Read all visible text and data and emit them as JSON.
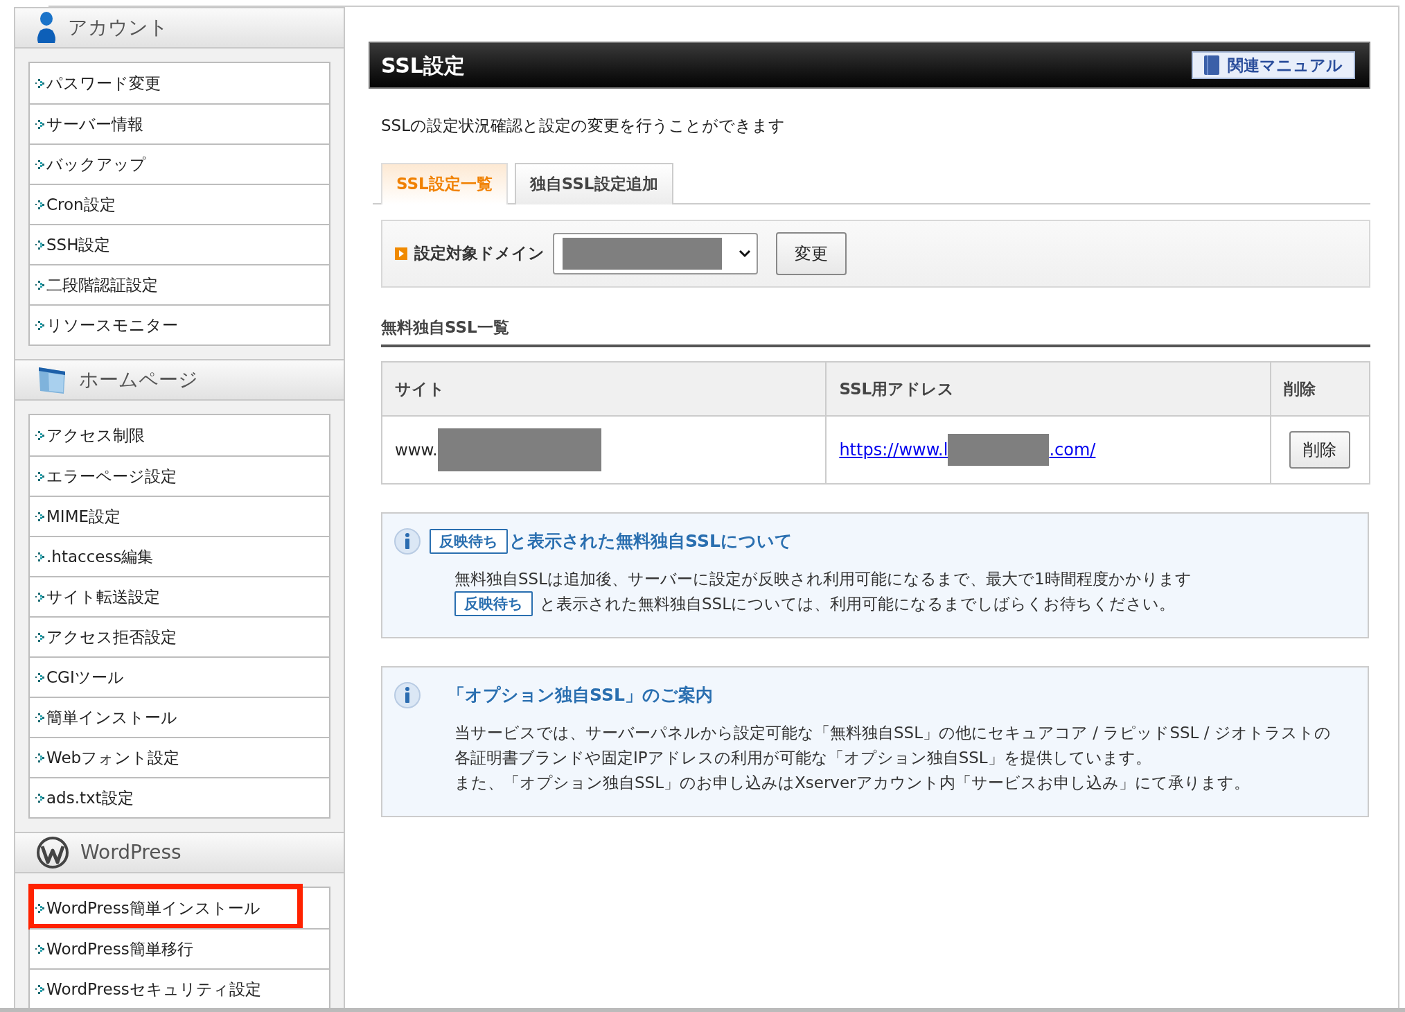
{
  "sidebar": {
    "sections": [
      {
        "kind": "account",
        "title": "アカウント",
        "items": [
          {
            "label": "パスワード変更",
            "highlighted": false
          },
          {
            "label": "サーバー情報",
            "highlighted": false
          },
          {
            "label": "バックアップ",
            "highlighted": false
          },
          {
            "label": "Cron設定",
            "highlighted": false
          },
          {
            "label": "SSH設定",
            "highlighted": false
          },
          {
            "label": "二段階認証設定",
            "highlighted": false
          },
          {
            "label": "リソースモニター",
            "highlighted": false
          }
        ]
      },
      {
        "kind": "homepage",
        "title": "ホームページ",
        "items": [
          {
            "label": "アクセス制限",
            "highlighted": false
          },
          {
            "label": "エラーページ設定",
            "highlighted": false
          },
          {
            "label": "MIME設定",
            "highlighted": false
          },
          {
            "label": ".htaccess編集",
            "highlighted": false
          },
          {
            "label": "サイト転送設定",
            "highlighted": false
          },
          {
            "label": "アクセス拒否設定",
            "highlighted": false
          },
          {
            "label": "CGIツール",
            "highlighted": false
          },
          {
            "label": "簡単インストール",
            "highlighted": false
          },
          {
            "label": "Webフォント設定",
            "highlighted": false
          },
          {
            "label": "ads.txt設定",
            "highlighted": false
          }
        ]
      },
      {
        "kind": "wordpress",
        "title": "WordPress",
        "items": [
          {
            "label": "WordPress簡単インストール",
            "highlighted": true
          },
          {
            "label": "WordPress簡単移行",
            "highlighted": false
          },
          {
            "label": "WordPressセキュリティ設定",
            "highlighted": false
          }
        ]
      }
    ]
  },
  "main": {
    "title": "SSL設定",
    "manual_button": "関連マニュアル",
    "description": "SSLの設定状況確認と設定の変更を行うことができます",
    "tabs": [
      {
        "label": "SSL設定一覧",
        "selected": true
      },
      {
        "label": "独自SSL設定追加",
        "selected": false
      }
    ],
    "domain_filter": {
      "label": "設定対象ドメイン",
      "button": "変更"
    },
    "section_title": "無料独自SSL一覧",
    "table": {
      "columns": [
        "サイト",
        "SSL用アドレス",
        "削除"
      ],
      "rows": [
        {
          "site": "www.",
          "url_start": "https://www.l",
          "url_end": ".com/",
          "action": "削除"
        }
      ]
    },
    "notices": [
      {
        "title_badge": "反映待ち",
        "title": "と表示された無料独自SSLについて",
        "lines": [
          {
            "text": "無料独自SSLは追加後、サーバーに設定が反映され利用可能になるまで、最大で1時間程度かかります"
          },
          {
            "badge": "反映待ち",
            "text": "と表示された無料独自SSLについては、利用可能になるまでしばらくお待ちください。"
          }
        ]
      },
      {
        "title": "「オプション独自SSL」のご案内",
        "lines": [
          {
            "text": "当サービスでは、サーバーパネルから設定可能な「無料独自SSL」の他にセキュアコア / ラピッドSSL / ジオトラストの各証明書ブランドや固定IPアドレスの利用が可能な「オプション独自SSL」を提供しています。"
          },
          {
            "text": "また、「オプション独自SSL」のお申し込みはXserverアカウント内「サービスお申し込み」にて承ります。"
          }
        ]
      }
    ]
  }
}
